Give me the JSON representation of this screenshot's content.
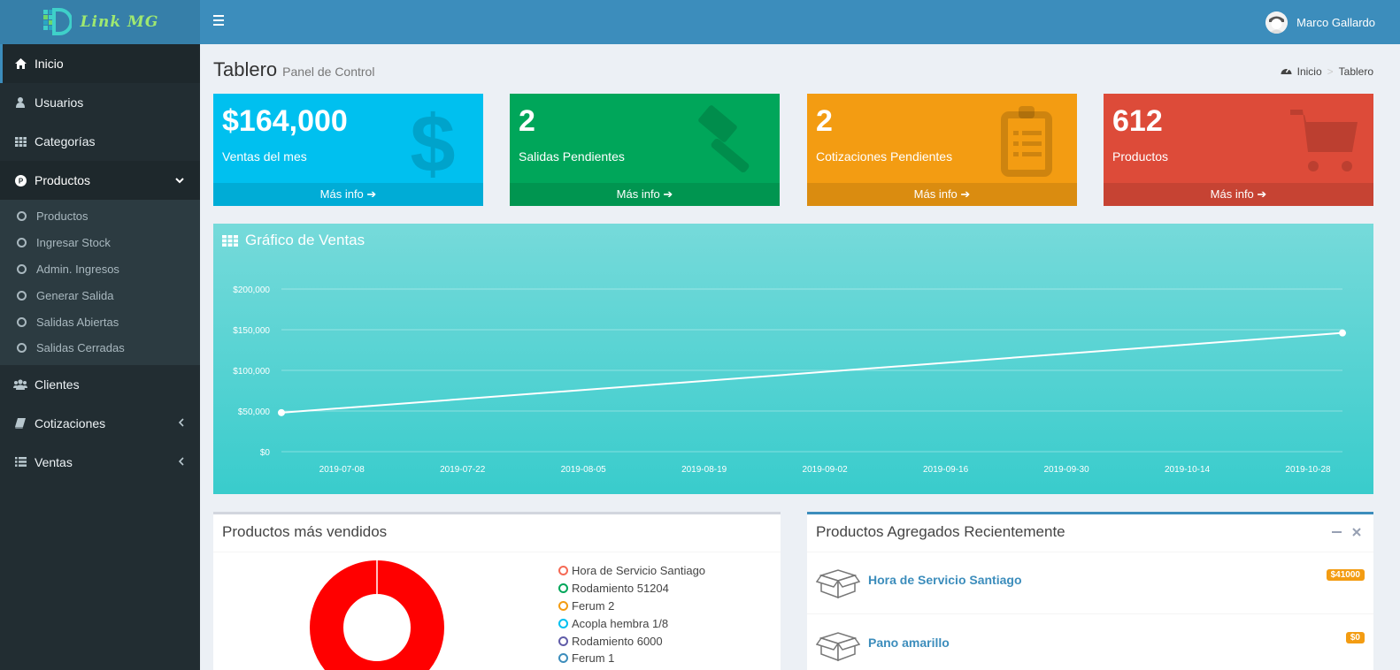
{
  "brand": {
    "logo_text": "Link  MG"
  },
  "header": {
    "user_name": "Marco Gallardo"
  },
  "sidebar": {
    "items": [
      {
        "label": "Inicio",
        "icon": "home-icon"
      },
      {
        "label": "Usuarios",
        "icon": "user-icon"
      },
      {
        "label": "Categorías",
        "icon": "grid-icon"
      },
      {
        "label": "Productos",
        "icon": "p-circle-icon"
      },
      {
        "label": "Clientes",
        "icon": "users-icon"
      },
      {
        "label": "Cotizaciones",
        "icon": "book-icon"
      },
      {
        "label": "Ventas",
        "icon": "list-icon"
      }
    ],
    "submenu": [
      "Productos",
      "Ingresar Stock",
      "Admin. Ingresos",
      "Generar Salida",
      "Salidas Abiertas",
      "Salidas Cerradas"
    ]
  },
  "page": {
    "title": "Tablero",
    "subtitle": "Panel de Control"
  },
  "breadcrumb": {
    "home": "Inicio",
    "sep": ">",
    "current": "Tablero"
  },
  "stats": [
    {
      "value": "$164,000",
      "label": "Ventas del mes",
      "more": "Más info",
      "color": "#00c0ef",
      "icon": "dollar-icon"
    },
    {
      "value": "2",
      "label": "Salidas Pendientes",
      "more": "Más info",
      "color": "#00a65a",
      "icon": "gavel-icon"
    },
    {
      "value": "2",
      "label": "Cotizaciones Pendientes",
      "more": "Más info",
      "color": "#f39c12",
      "icon": "clipboard-icon"
    },
    {
      "value": "612",
      "label": "Productos",
      "more": "Más info",
      "color": "#dd4b39",
      "icon": "cart-icon"
    }
  ],
  "sales_chart": {
    "title": "Gráfico de Ventas"
  },
  "chart_data": {
    "type": "line",
    "title": "Gráfico de Ventas",
    "x": [
      "2019-07-01",
      "2019-11-01"
    ],
    "y": [
      48000,
      146000
    ],
    "xticks": [
      "2019-07-08",
      "2019-07-22",
      "2019-08-05",
      "2019-08-19",
      "2019-09-02",
      "2019-09-16",
      "2019-09-30",
      "2019-10-14",
      "2019-10-28"
    ],
    "yticks": [
      "$0",
      "$50,000",
      "$100,000",
      "$150,000",
      "$200,000"
    ],
    "ylim": [
      0,
      200000
    ],
    "grid": true,
    "line_color": "#ffffff"
  },
  "top_products": {
    "title": "Productos más vendidos",
    "legend": [
      {
        "label": "Hora de Servicio Santiago",
        "color": "#f56954"
      },
      {
        "label": "Rodamiento 51204",
        "color": "#00a65a"
      },
      {
        "label": "Ferum 2",
        "color": "#f39c12"
      },
      {
        "label": "Acopla hembra 1/8",
        "color": "#00c0ef"
      },
      {
        "label": "Rodamiento 6000",
        "color": "#605ca8"
      },
      {
        "label": "Ferum 1",
        "color": "#3c8dbc"
      }
    ]
  },
  "recent_products": {
    "title": "Productos Agregados Recientemente",
    "items": [
      {
        "name": "Hora de Servicio Santiago",
        "price": "$41000"
      },
      {
        "name": "Pano amarillo",
        "price": "$0"
      }
    ]
  }
}
